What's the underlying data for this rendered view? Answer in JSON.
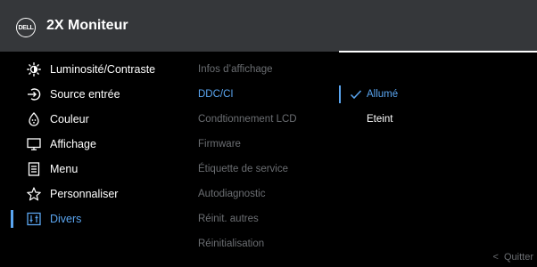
{
  "header": {
    "brand": "DELL",
    "title": "2X Moniteur"
  },
  "menu": {
    "items": [
      {
        "label": "Luminosité/Contraste",
        "icon": "brightness-icon"
      },
      {
        "label": "Source entrée",
        "icon": "input-source-icon"
      },
      {
        "label": "Couleur",
        "icon": "color-palette-icon"
      },
      {
        "label": "Affichage",
        "icon": "display-icon"
      },
      {
        "label": "Menu",
        "icon": "menu-document-icon"
      },
      {
        "label": "Personnaliser",
        "icon": "star-icon"
      },
      {
        "label": "Divers",
        "icon": "settings-sliders-icon"
      }
    ],
    "selected": "Divers"
  },
  "submenu": {
    "items": [
      "Infos d’affichage",
      "DDC/CI",
      "Condtionnement LCD",
      "Firmware",
      "Étiquette de service",
      "Autodiagnostic",
      "Réinit. autres",
      "Réinitialisation"
    ],
    "active": "DDC/CI"
  },
  "options": {
    "items": [
      "Allumé",
      "Eteint"
    ],
    "checked": "Allumé"
  },
  "footer": {
    "quit_label": "Quitter",
    "quit_icon": "chevron-left-icon"
  },
  "colors": {
    "accent": "#5aa5f0",
    "title_bar": "#35373a",
    "background": "#000000",
    "dim_text": "#6b6e72"
  }
}
